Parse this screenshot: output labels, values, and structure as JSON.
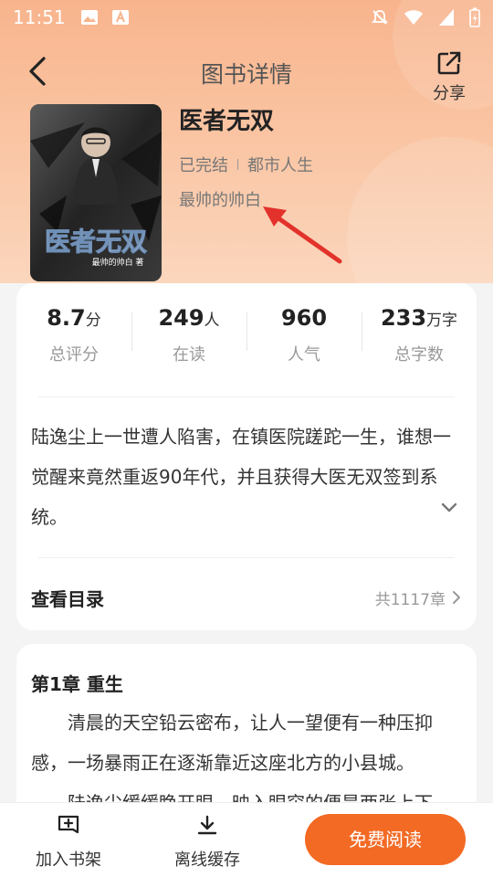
{
  "status_bar": {
    "time": "11:51"
  },
  "nav": {
    "title": "图书详情",
    "share_label": "分享"
  },
  "book": {
    "title": "医者无双",
    "status": "已完结",
    "genre": "都市人生",
    "author": "最帅的帅白",
    "cover_title": "医者无双",
    "cover_subtitle": "最帅的帅白 著"
  },
  "stats": [
    {
      "value": "8.7",
      "unit": "分",
      "label": "总评分"
    },
    {
      "value": "249",
      "unit": "人",
      "label": "在读"
    },
    {
      "value": "960",
      "unit": "",
      "label": "人气"
    },
    {
      "value": "233",
      "unit": "万字",
      "label": "总字数"
    }
  ],
  "description": "陆逸尘上一世遭人陷害，在镇医院蹉跎一生，谁想一觉醒来竟然重返90年代，并且获得大医无双签到系统。",
  "toc": {
    "label": "查看目录",
    "count": "共1117章"
  },
  "chapter": {
    "title": "第1章 重生",
    "para1": "清晨的天空铅云密布，让人一望便有一种压抑感，一场暴雨正在逐渐靠近这座北方的小县城。",
    "para2": "陆逸尘缓缓睁开眼，映入眼帘的便是两张上下"
  },
  "bottom_bar": {
    "add_shelf": "加入书架",
    "offline_cache": "离线缓存",
    "read_free": "免费阅读"
  },
  "colors": {
    "accent": "#f36a24",
    "header_bg": "#f8b48d"
  }
}
